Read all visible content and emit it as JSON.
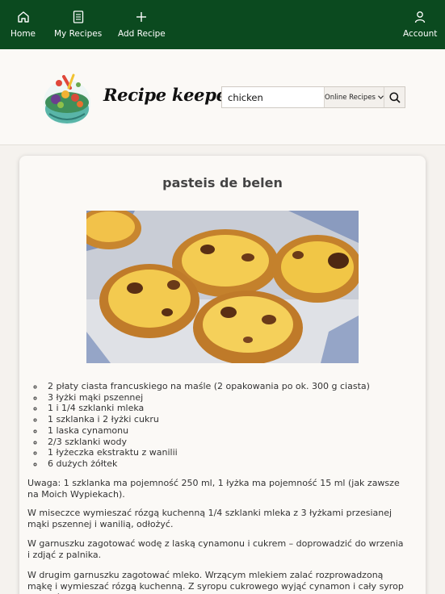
{
  "nav": {
    "home": "Home",
    "my_recipes": "My Recipes",
    "add_recipe": "Add Recipe",
    "account": "Account"
  },
  "header": {
    "brand": "Recipe keeper",
    "search_value": "chicken",
    "source_select": "Online Recipes"
  },
  "recipe": {
    "title": "pasteis de belen",
    "ingredients": [
      "2 płaty ciasta francuskiego na maśle (2 opakowania po ok. 300 g ciasta)",
      "3 łyżki mąki pszennej",
      "1 i 1/4 szklanki mleka",
      "1 szklanka i 2 łyżki cukru",
      "1 laska cynamonu",
      "2/3 szklanki wody",
      "1 łyżeczka ekstraktu z wanilii",
      "6 dużych żółtek"
    ],
    "paragraphs": [
      "Uwaga: 1 szklanka ma pojemność 250 ml, 1 łyżka ma pojemność 15 ml (jak zawsze na Moich Wypiekach).",
      "W miseczce wymieszać rózgą kuchenną 1/4 szklanki mleka z 3 łyżkami przesianej mąki pszennej i wanilią, odłożyć.",
      "W garnuszku zagotować wodę z laską cynamonu i cukrem – doprowadzić do wrzenia i zdjąć z palnika.",
      "W drugim garnuszku zagotować mleko. Wrzącym mlekiem zalać rozprowadzoną mąkę i wymieszać rózgą kuchenną. Z syropu cukrowego wyjąć cynamon i cały syrop przelać do"
    ]
  },
  "colors": {
    "nav_bg": "#0b4a1f",
    "page_bg": "#f5f2ee",
    "card_bg": "#fbf9f6"
  },
  "icons": {
    "home": "home-icon",
    "my_recipes": "book-icon",
    "add_recipe": "plus-icon",
    "account": "user-icon",
    "search": "search-icon"
  }
}
